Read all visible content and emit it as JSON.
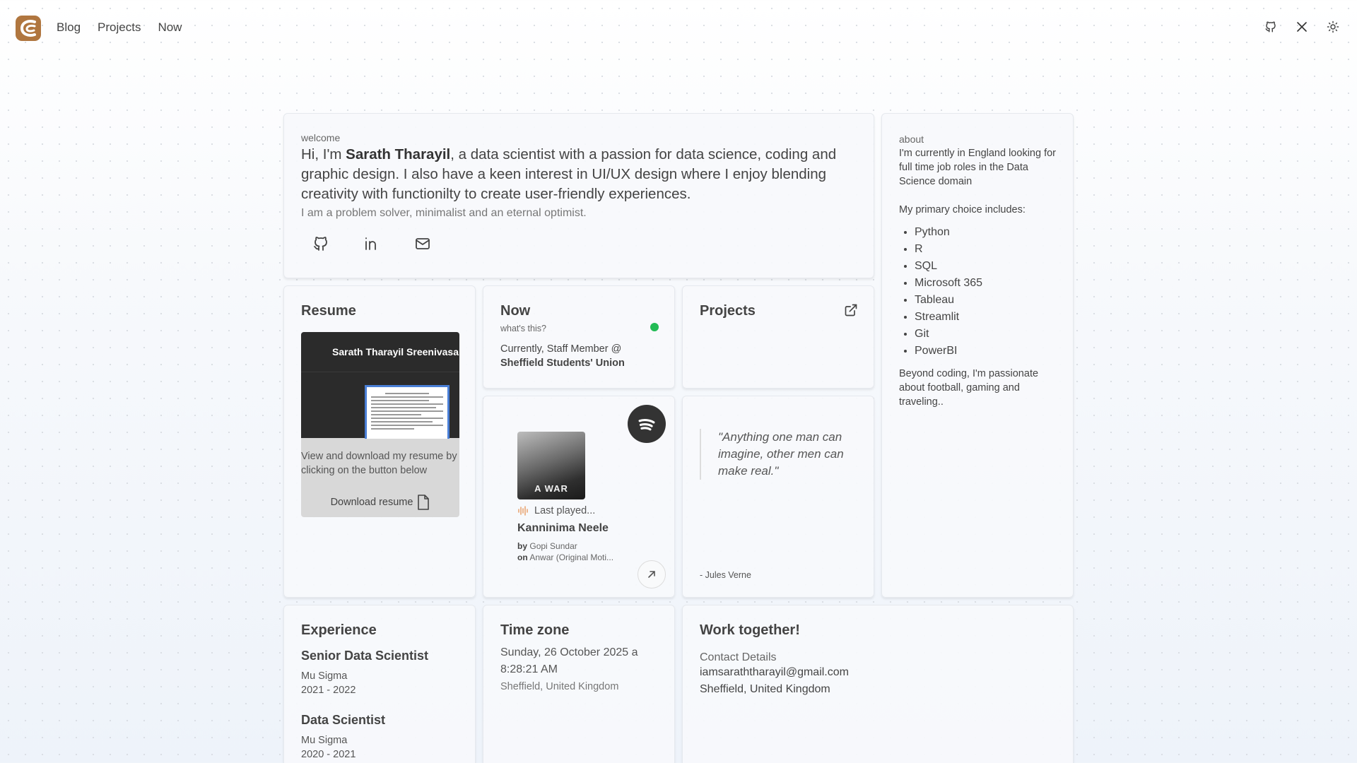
{
  "nav": {
    "links": [
      "Blog",
      "Projects",
      "Now"
    ],
    "icons": [
      "github-icon",
      "x-icon",
      "sun-icon"
    ],
    "brand_color": "#b0763f"
  },
  "welcome": {
    "label": "welcome",
    "intro_prefix": "Hi, I'm ",
    "name": "Sarath Tharayil",
    "intro_suffix": ", a data scientist with a passion for data science, coding and graphic design. I also have a keen interest in UI/UX design where I enjoy blending creativity with functionilty to create user-friendly experiences.",
    "tagline": "I am a problem solver, minimalist and an eternal optimist.",
    "socials": [
      "github-icon",
      "linkedin-icon",
      "mail-icon"
    ]
  },
  "about": {
    "label": "about",
    "text1": "I'm currently in England looking for full time job roles in the Data Science domain",
    "text2": "My primary choice includes:",
    "skills": [
      "Python",
      "R",
      "SQL",
      "Microsoft 365",
      "Tableau",
      "Streamlit",
      "Git",
      "PowerBI"
    ],
    "text3": "Beyond coding, I'm passionate about football, gaming and traveling.."
  },
  "resume": {
    "title": "Resume",
    "viewer_title": "Sarath Tharayil Sreenivasan",
    "text": "View and download my resume by clicking on the button below",
    "button": "Download resume"
  },
  "now": {
    "title": "Now",
    "sub": "what's this?",
    "current": "Currently, Staff Member @",
    "org": "Sheffield Students' Union",
    "status_color": "#22bb55"
  },
  "projects": {
    "title": "Projects"
  },
  "spotify": {
    "album_text": "A WAR",
    "last_played": "Last played...",
    "track": "Kanninima Neele",
    "by_label": "by",
    "artist": "Gopi Sundar",
    "on_label": "on",
    "album": "Anwar (Original Moti..."
  },
  "quote": {
    "text": "\"Anything one man can imagine, other men can make real.\"",
    "author": "- Jules Verne"
  },
  "experience": {
    "title": "Experience",
    "jobs": [
      {
        "title": "Senior Data Scientist",
        "company": "Mu Sigma",
        "years": "2021 - 2022"
      },
      {
        "title": "Data Scientist",
        "company": "Mu Sigma",
        "years": "2020 - 2021"
      }
    ]
  },
  "timezone": {
    "title": "Time zone",
    "datetime": "Sunday, 26 October 2025 a 8:28:21 AM",
    "location": "Sheffield, United Kingdom"
  },
  "work": {
    "title": "Work together!",
    "label": "Contact Details",
    "email": "iamsaraththarayil@gmail.com",
    "location": "Sheffield, United Kingdom"
  }
}
